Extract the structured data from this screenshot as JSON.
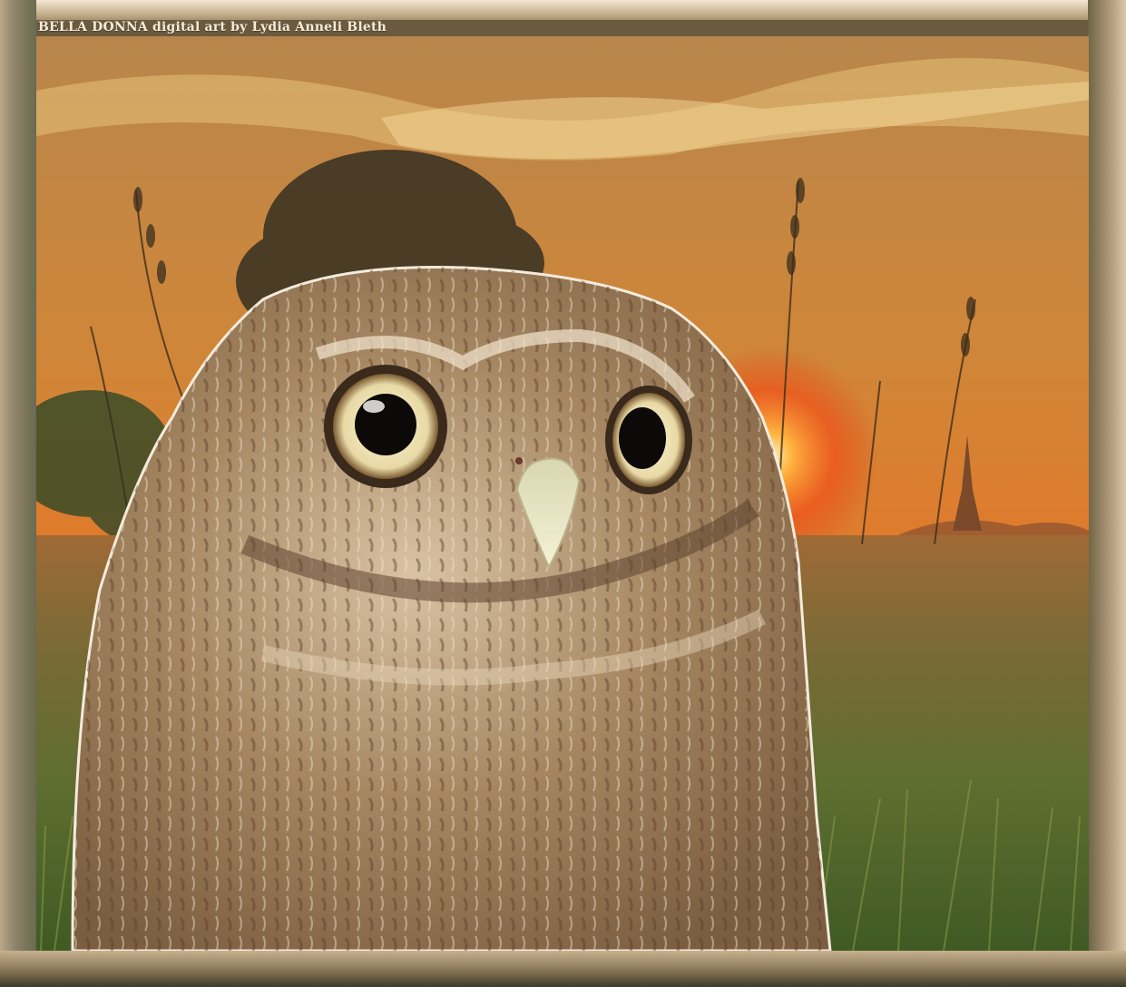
{
  "caption": "BELLA DONNA digital art by Lydia Anneli Bleth",
  "image": {
    "subject": "owl-portrait",
    "scene": "sunset-meadow",
    "colors": {
      "sky_top": "#c4894a",
      "sky_mid": "#e07a2c",
      "sun_glow": "#f04a12",
      "meadow": "#5e6b32",
      "owl_fur_light": "#e7d6bd",
      "owl_fur_dark": "#6e4e33",
      "eye_iris": "#efe2b8",
      "beak": "#ecebc9",
      "frame_light": "#efe3d0",
      "frame_dark": "#6a6a4f"
    }
  }
}
